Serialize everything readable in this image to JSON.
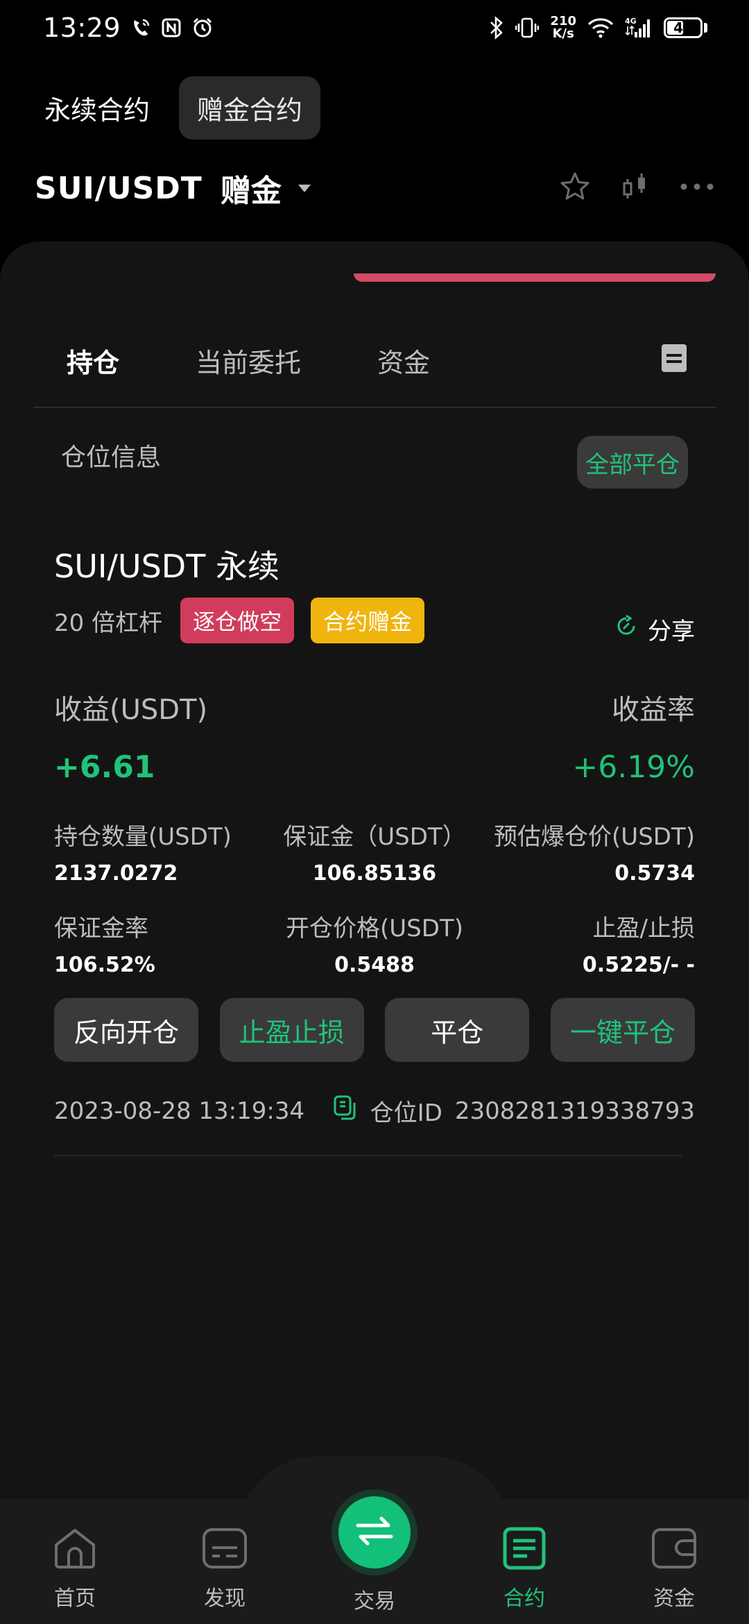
{
  "status_bar": {
    "time": "13:29",
    "net_speed_value": "210",
    "net_speed_unit": "K/s",
    "network": "4G",
    "battery": "45"
  },
  "contract_tabs": [
    "永续合约",
    "赠金合约"
  ],
  "pair": {
    "name": "SUI/USDT",
    "tag": "赠金"
  },
  "tabs": [
    "持仓",
    "当前委托",
    "资金"
  ],
  "section": {
    "title": "仓位信息",
    "close_all": "全部平仓"
  },
  "position": {
    "title": "SUI/USDT 永续",
    "leverage": "20 倍杠杆",
    "badge_short": "逐仓做空",
    "badge_bonus": "合约赠金",
    "share": "分享",
    "pnl_label": "收益(USDT)",
    "pnl_rate_label": "收益率",
    "pnl_value": "+6.61",
    "pnl_rate_value": "+6.19%",
    "fields_row1": [
      {
        "label": "持仓数量(USDT)",
        "value": "2137.0272"
      },
      {
        "label": "保证金（USDT）",
        "value": "106.85136"
      },
      {
        "label": "预估爆仓价(USDT)",
        "value": "0.5734"
      }
    ],
    "fields_row2": [
      {
        "label": "保证金率",
        "value": "106.52%"
      },
      {
        "label": "开仓价格(USDT)",
        "value": "0.5488"
      },
      {
        "label": "止盈/止损",
        "value": "0.5225/- -"
      }
    ],
    "actions": [
      "反向开仓",
      "止盈止损",
      "平仓",
      "一键平仓"
    ],
    "timestamp": "2023-08-28 13:19:34",
    "position_id_label": "仓位ID",
    "position_id": "2308281319338793"
  },
  "bottom_nav": [
    {
      "label": "首页",
      "icon": "home-icon"
    },
    {
      "label": "发现",
      "icon": "discover-icon"
    },
    {
      "label": "交易",
      "icon": "swap-icon"
    },
    {
      "label": "合约",
      "icon": "contract-icon"
    },
    {
      "label": "资金",
      "icon": "wallet-icon"
    }
  ],
  "colors": {
    "accent_green": "#1fc37a",
    "short_red": "#d13c5c",
    "bonus_yellow": "#f0b40e",
    "accent_line": "#d24a63"
  }
}
